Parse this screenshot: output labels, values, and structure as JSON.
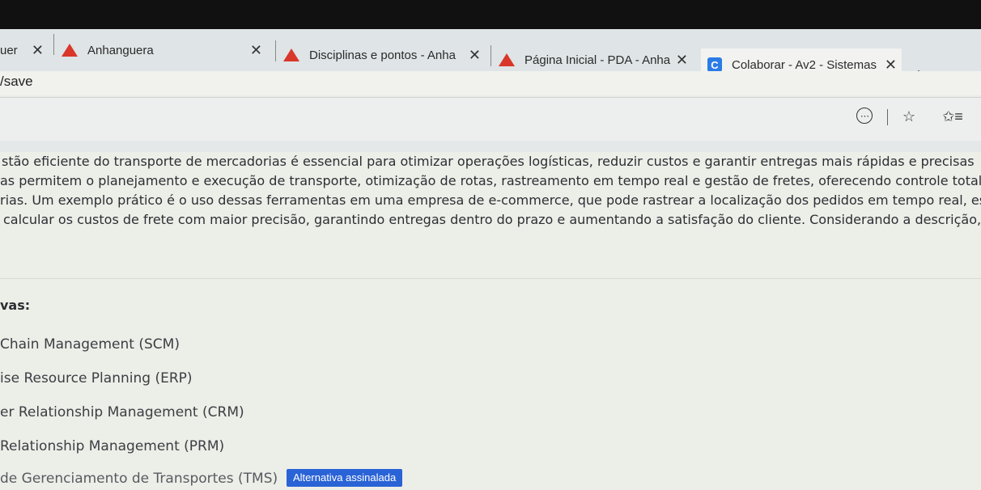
{
  "tabs": [
    {
      "title": "uer",
      "icon": "none",
      "close": "✕"
    },
    {
      "title": "Anhanguera",
      "icon": "warning-triangle-icon",
      "close": "✕"
    },
    {
      "title": "Disciplinas e pontos - Anha",
      "icon": "warning-triangle-icon",
      "close": "✕"
    },
    {
      "title": "Página Inicial - PDA - Anha",
      "icon": "warning-triangle-icon",
      "close": "✕"
    },
    {
      "title": "Colaborar - Av2 - Sistemas",
      "icon": "c-icon",
      "icon_text": "C",
      "close": "✕"
    }
  ],
  "new_tab": "+",
  "address": {
    "text": "/save"
  },
  "toolbar": {
    "more_icon": "⋯",
    "star_icon": "☆",
    "favorites_icon": "✩≡"
  },
  "question": {
    "lines": [
      "stão eficiente do transporte de mercadorias é essencial para otimizar operações logísticas, reduzir custos e garantir entregas mais rápidas e precisas",
      "as permitem o planejamento e execução de transporte, otimização de rotas, rastreamento em tempo real e gestão de fretes, oferecendo controle total so",
      "rias. Um exemplo prático é o uso dessas ferramentas em uma empresa de e-commerce, que pode rastrear a localização dos pedidos em tempo real, escol",
      "calcular os custos de frete com maior precisão, garantindo entregas dentro do prazo e aumentando a satisfação do cliente. Considerando a descrição, i"
    ],
    "label": "vas:"
  },
  "options": [
    "Chain Management (SCM)",
    "ise Resource Planning (ERP)",
    "er Relationship Management (CRM)",
    "Relationship Management (PRM)",
    "de Gerenciamento de Transportes (TMS)"
  ],
  "badge": "Alternativa assinalada",
  "colors": {
    "accent": "#2a63d6",
    "favicon_red": "#d8372a",
    "favicon_blue": "#2c7be5"
  }
}
